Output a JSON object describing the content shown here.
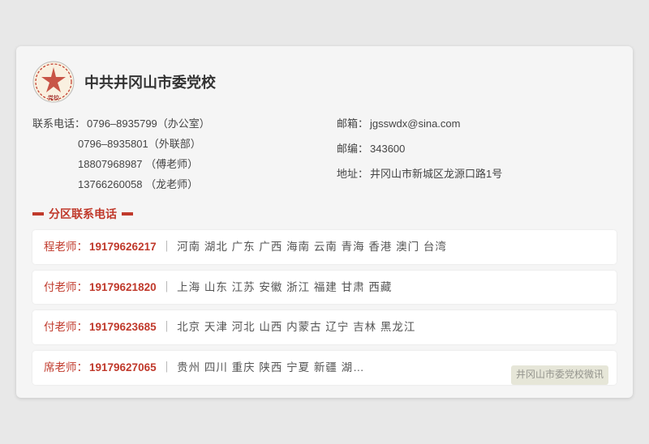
{
  "org": {
    "title": "中共井冈山市委党校",
    "logo_text": "党校"
  },
  "contact_info": {
    "phone_label": "联系电话：",
    "phones": [
      {
        "number": "0796–8935799",
        "note": "（办公室）"
      },
      {
        "number": "0796–8935801",
        "note": "（外联部）"
      },
      {
        "number": "18807968987",
        "note": "（傅老师）"
      },
      {
        "number": "13766260058",
        "note": "（龙老师）"
      }
    ],
    "email_label": "邮箱：",
    "email": "jgsswdx@sina.com",
    "postcode_label": "邮编：",
    "postcode": "343600",
    "address_label": "地址：",
    "address": "井冈山市新城区龙源口路1号"
  },
  "section_title": "分区联系电话",
  "contacts": [
    {
      "name": "程老师：",
      "phone": "19179626217",
      "separator": "｜",
      "regions": "河南  湖北  广东  广西  海南  云南  青海  香港  澳门  台湾"
    },
    {
      "name": "付老师：",
      "phone": "19179621820",
      "separator": "｜",
      "regions": "上海  山东  江苏  安徽  浙江  福建  甘肃  西藏"
    },
    {
      "name": "付老师：",
      "phone": "19179623685",
      "separator": "｜",
      "regions": "北京  天津  河北  山西  内蒙古  辽宁  吉林  黑龙江"
    },
    {
      "name": "席老师：",
      "phone": "19179627065",
      "separator": "｜",
      "regions": "贵州  四川  重庆  陕西  宁夏  新疆  湖…"
    }
  ],
  "watermark": "井冈山市委党校微讯"
}
